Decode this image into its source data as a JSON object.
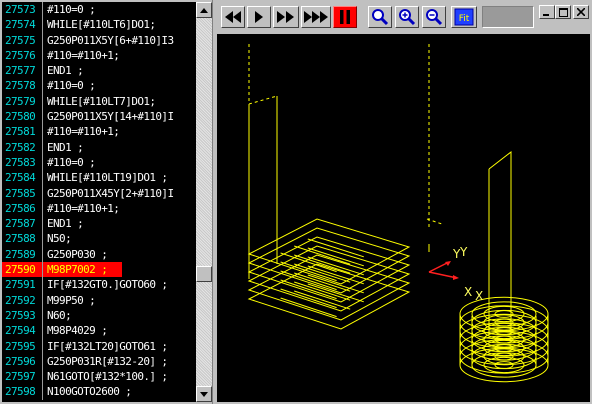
{
  "code": {
    "lines": [
      {
        "no": "27573",
        "text": "#110=0 ;"
      },
      {
        "no": "27574",
        "text": "WHILE[#110LT6]DO1;"
      },
      {
        "no": "27575",
        "text": "G250P011X5Y[6+#110]I3"
      },
      {
        "no": "27576",
        "text": "#110=#110+1;"
      },
      {
        "no": "27577",
        "text": "END1 ;"
      },
      {
        "no": "27578",
        "text": "#110=0 ;"
      },
      {
        "no": "27579",
        "text": "WHILE[#110LT7]DO1;"
      },
      {
        "no": "27580",
        "text": "G250P011X5Y[14+#110]I"
      },
      {
        "no": "27581",
        "text": "#110=#110+1;"
      },
      {
        "no": "27582",
        "text": "END1 ;"
      },
      {
        "no": "27583",
        "text": "#110=0 ;"
      },
      {
        "no": "27584",
        "text": "WHILE[#110LT19]DO1 ;"
      },
      {
        "no": "27585",
        "text": "G250P011X45Y[2+#110]I"
      },
      {
        "no": "27586",
        "text": "#110=#110+1;"
      },
      {
        "no": "27587",
        "text": "END1 ;"
      },
      {
        "no": "27588",
        "text": "N50;"
      },
      {
        "no": "27589",
        "text": "G250P030 ;"
      },
      {
        "no": "27590",
        "text": "M98P7002 ;"
      },
      {
        "no": "27591",
        "text": "IF[#132GT0.]GOTO60 ;"
      },
      {
        "no": "27592",
        "text": "M99P50 ;"
      },
      {
        "no": "27593",
        "text": "N60;"
      },
      {
        "no": "27594",
        "text": "M98P4029 ;"
      },
      {
        "no": "27595",
        "text": "IF[#132LT20]GOTO61 ;"
      },
      {
        "no": "27596",
        "text": "G250P031R[#132-20] ;"
      },
      {
        "no": "27597",
        "text": "N61GOTO[#132*100.] ;"
      },
      {
        "no": "27598",
        "text": "N100GOTO2600 ;"
      }
    ],
    "active_line": "27590"
  },
  "toolbar": {
    "buttons": [
      {
        "name": "rewind-button",
        "icon": "rewind-icon"
      },
      {
        "name": "play-button",
        "icon": "play-icon"
      },
      {
        "name": "fast-forward-button",
        "icon": "fast-forward-icon"
      },
      {
        "name": "fastest-forward-button",
        "icon": "fastest-forward-icon"
      },
      {
        "name": "pause-button",
        "icon": "pause-icon",
        "active": true
      },
      {
        "name": "zoom-button",
        "icon": "magnifier-icon"
      },
      {
        "name": "zoom-in-button",
        "icon": "zoom-in-icon"
      },
      {
        "name": "zoom-out-button",
        "icon": "zoom-out-icon"
      },
      {
        "name": "fit-button",
        "icon": "fit-icon"
      }
    ],
    "fit_label": "Fit"
  },
  "window_controls": [
    "minimize-icon",
    "maximize-icon",
    "close-icon"
  ],
  "viewer": {
    "axis_y_label": "Y",
    "axis_x_label": "X",
    "part_axis_y_label": "Y",
    "part_axis_x_label": "X"
  },
  "colors": {
    "code_background": "#000000",
    "line_number": "#00d8d8",
    "code_text": "#ffffff",
    "active_highlight": "#ff0000",
    "active_text": "#ffff00",
    "toolpath": "#ffff00",
    "axis_arrow": "#ff2020"
  }
}
